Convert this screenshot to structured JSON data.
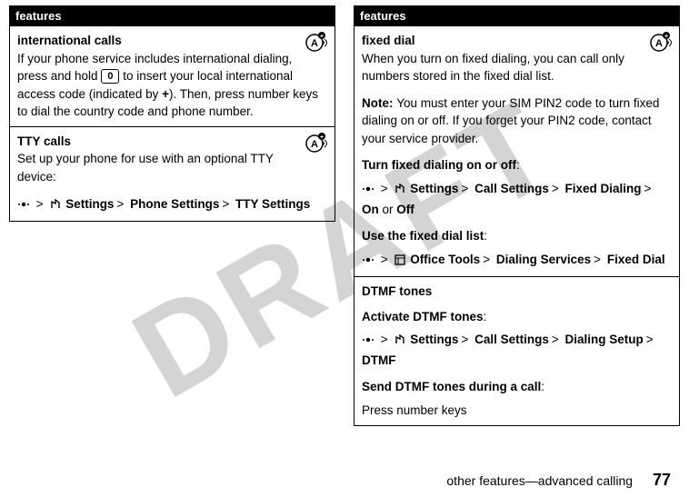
{
  "watermark": "DRAFT",
  "sym": {
    "gt": ">"
  },
  "left": {
    "header": "features",
    "intl": {
      "title": "international calls",
      "body_a": "If your phone service includes international dialing, press and hold ",
      "key": "0",
      "body_b": " to insert your local international access code (indicated by ",
      "plus": "+",
      "body_c": "). Then, press number keys to dial the country code and phone number."
    },
    "tty": {
      "title": "TTY calls",
      "body": "Set up your phone for use with an optional TTY device:",
      "p1": "Settings",
      "p2": "Phone Settings",
      "p3": "TTY Settings"
    }
  },
  "right": {
    "header": "features",
    "fixed": {
      "title": "fixed dial",
      "body": "When you turn on fixed dialing, you can call only numbers stored in the fixed dial list.",
      "note_label": "Note: ",
      "note_body": "You must enter your SIM PIN2 code to turn fixed dialing on or off. If you forget your PIN2 code, contact your service provider.",
      "toggle_label": "Turn fixed dialing on or off",
      "tp1": "Settings",
      "tp2": "Call Settings",
      "tp3": "Fixed Dialing",
      "tp4": "On",
      "or": " or ",
      "tp5": "Off",
      "list_label": "Use the fixed dial list",
      "lp1": "Office Tools",
      "lp2": "Dialing Services",
      "lp3": "Fixed Dial"
    },
    "dtmf": {
      "title": "DTMF tones",
      "activate_label": "Activate DTMF tones",
      "p1": "Settings",
      "p2": "Call Settings",
      "p3": "Dialing Setup",
      "p4": "DTMF",
      "send_label": "Send DTMF tones during a call",
      "send_body": "Press number keys"
    }
  },
  "footer": {
    "text": "other features—advanced calling",
    "page": "77"
  }
}
